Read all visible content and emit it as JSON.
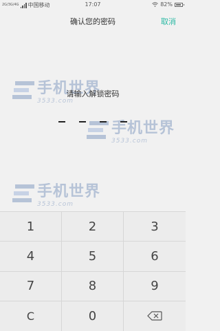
{
  "status_bar": {
    "network_type": "2G/3G/4G",
    "carrier": "中国移动",
    "time": "17:07",
    "battery": "82%",
    "battery_level": 0.82
  },
  "header": {
    "title": "确认您的密码",
    "cancel_label": "取消"
  },
  "prompt": "请输入解锁密码",
  "watermark": {
    "brand": "手机世界",
    "domain": "3533.com"
  },
  "keypad": {
    "keys": [
      "1",
      "2",
      "3",
      "4",
      "5",
      "6",
      "7",
      "8",
      "9",
      "C",
      "0",
      "⌫"
    ]
  },
  "colors": {
    "accent": "#2bb9a4",
    "background": "#f1f1f1"
  }
}
